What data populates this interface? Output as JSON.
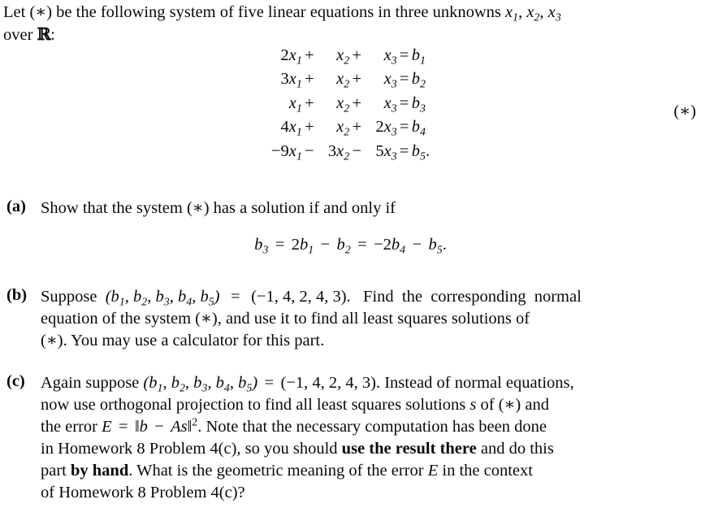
{
  "document": {
    "type": "math-homework-problem",
    "intro": {
      "line1_prefix": "Let ",
      "line1_tag": "(∗)",
      "line1_mid": " be the following system of five linear equations in three unknowns ",
      "unknowns": "x₁, x₂, x₃",
      "line2": "over ℝ:"
    },
    "system": {
      "tag": "(∗)",
      "rows": [
        {
          "t1": "2x₁",
          "op1": "+",
          "t2": "x₂",
          "op2": "+",
          "t3": "x₃",
          "eq": "=",
          "rhs": "b₁"
        },
        {
          "t1": "3x₁",
          "op1": "+",
          "t2": "x₂",
          "op2": "+",
          "t3": "x₃",
          "eq": "=",
          "rhs": "b₂"
        },
        {
          "t1": "x₁",
          "op1": "+",
          "t2": "x₂",
          "op2": "+",
          "t3": "x₃",
          "eq": "=",
          "rhs": "b₃"
        },
        {
          "t1": "4x₁",
          "op1": "+",
          "t2": "x₂",
          "op2": "+",
          "t3": "2x₃",
          "eq": "=",
          "rhs": "b₄"
        },
        {
          "t1": "−9x₁",
          "op1": "−",
          "t2": "3x₂",
          "op2": "−",
          "t3": "5x₃",
          "eq": "=",
          "rhs": "b₅."
        }
      ]
    },
    "parts": [
      {
        "marker": "(a)",
        "text": "Show that the system (∗) has a solution if and only if",
        "display_equation": "b₃ = 2b₁ − b₂ = −2b₄ − b₅."
      },
      {
        "marker": "(b)",
        "line1": "Suppose  (b₁, b₂, b₃, b₄, b₅)  =  (−1, 4, 2, 4, 3).   Find  the  corresponding  normal",
        "line2": "equation of the system (∗), and use it to find all least squares solutions of",
        "line3": "(∗). You may use a calculator for this part.",
        "b_vector": "(−1, 4, 2, 4, 3)"
      },
      {
        "marker": "(c)",
        "line1": "Again suppose (b₁, b₂, b₃, b₄, b₅) = (−1, 4, 2, 4, 3). Instead of normal equations,",
        "line2": "now use orthogonal projection to find all least squares solutions s of (∗) and",
        "line3_a": "the error ",
        "line3_eq": "E = ‖b − As‖²",
        "line3_b": ". Note that the necessary computation has been done",
        "line4_a": "in Homework 8 Problem 4(c), so you should ",
        "line4_bold": "use the result there",
        "line4_b": " and do this",
        "line5_a": "part ",
        "line5_bold": "by hand",
        "line5_b": ". What is the geometric meaning of the error E in the context",
        "line6": "of Homework 8 Problem 4(c)?",
        "b_vector": "(−1, 4, 2, 4, 3)"
      }
    ]
  },
  "colors": {
    "text": "#0a0a0a",
    "background": "#ffffff"
  }
}
